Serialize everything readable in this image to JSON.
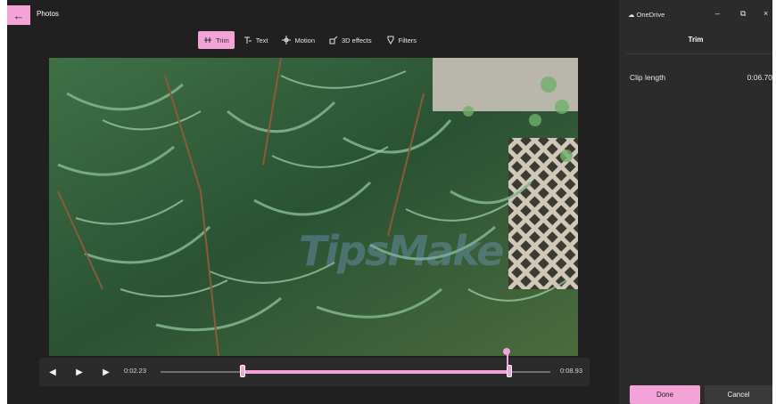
{
  "app": {
    "title": "Photos",
    "back_icon": "arrow-left-icon"
  },
  "toolbar": {
    "items": [
      {
        "label": "Trim",
        "icon": "trim-icon",
        "active": true
      },
      {
        "label": "Text",
        "icon": "text-icon",
        "active": false
      },
      {
        "label": "Motion",
        "icon": "motion-icon",
        "active": false
      },
      {
        "label": "3D effects",
        "icon": "3d-effects-icon",
        "active": false
      },
      {
        "label": "Filters",
        "icon": "filters-icon",
        "active": false
      }
    ]
  },
  "preview": {
    "watermark": "TipsMake"
  },
  "playback": {
    "current_time": "0:02.23",
    "end_time": "0:08.93",
    "buttons": [
      "previous-frame-icon",
      "play-icon",
      "next-frame-icon"
    ]
  },
  "window": {
    "onedrive_label": "OneDrive",
    "minimize": "–",
    "restore": "⧉",
    "close": "×"
  },
  "panel": {
    "title": "Trim",
    "clip_length_label": "Clip length",
    "clip_length_value": "0:06.70",
    "done_label": "Done",
    "cancel_label": "Cancel"
  },
  "colors": {
    "accent": "#f4a3d8",
    "background": "#202020",
    "panel": "#2b2b2b"
  }
}
